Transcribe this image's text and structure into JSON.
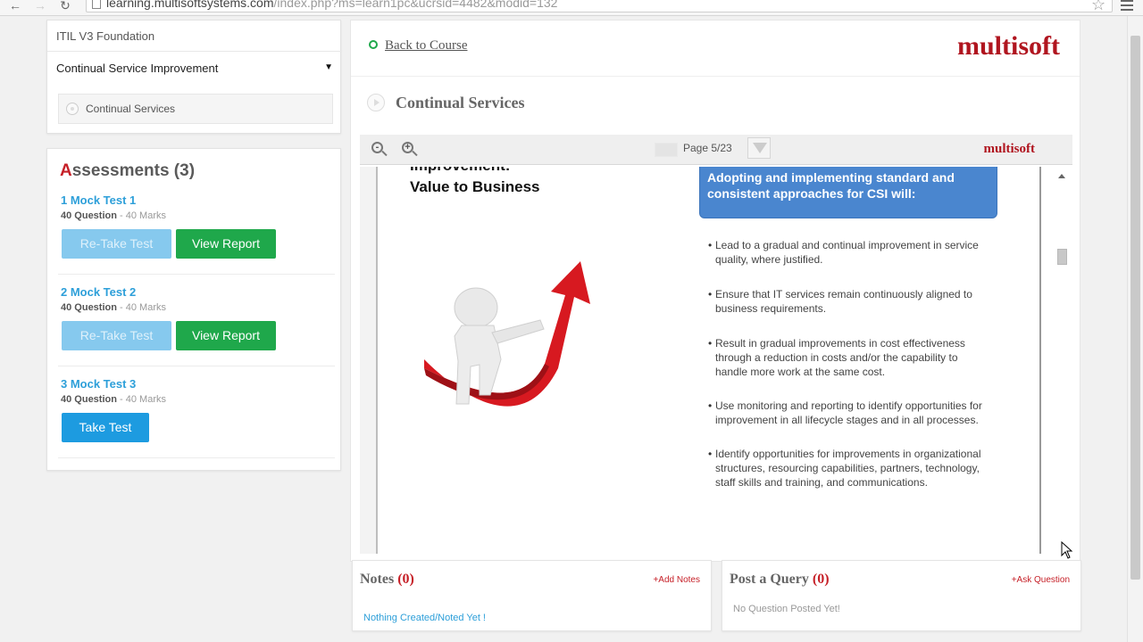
{
  "browser": {
    "url_host": "learning.multisoftsystems.com",
    "url_path": "/index.php?ms=learn1pc&ucrsid=4482&modid=132"
  },
  "sidebar": {
    "course_title": "ITIL V3 Foundation",
    "module": "Continual Service Improvement",
    "lesson": "Continual Services"
  },
  "assessments": {
    "title_first": "A",
    "title_rest": "ssessments (3)",
    "tests": [
      {
        "name": "1 Mock Test 1",
        "questions": "40 Question",
        "marks": " - 40 Marks",
        "primary_label": "Re-Take Test",
        "secondary_label": "View Report"
      },
      {
        "name": "2 Mock Test 2",
        "questions": "40 Question",
        "marks": " - 40 Marks",
        "primary_label": "Re-Take Test",
        "secondary_label": "View Report"
      },
      {
        "name": "3 Mock Test 3",
        "questions": "40 Question",
        "marks": " - 40 Marks",
        "primary_label": "Take Test"
      }
    ]
  },
  "main": {
    "back_label": "Back to Course",
    "logo": "multisoft",
    "lesson_title": "Continual Services"
  },
  "viewer": {
    "page_indicator": "Page 5/23",
    "logo": "multisoft"
  },
  "slide": {
    "title_line1": "Improvement:",
    "title_line2": "Value to Business",
    "callout": "Adopting and implementing standard and consistent approaches for CSI will:",
    "bullets": [
      "Lead to a gradual and continual improvement in service quality, where justified.",
      "Ensure that IT services remain continuously aligned to business requirements.",
      "Result in gradual improvements in cost effectiveness through a reduction in costs and/or the capability to handle more work at the same cost.",
      "Use monitoring and reporting to identify opportunities for improvement in all lifecycle stages and in all processes.",
      "Identify opportunities for improvements in organizational structures, resourcing capabilities, partners, technology, staff skills and training, and communications."
    ]
  },
  "notes": {
    "title": "Notes ",
    "count": "(0)",
    "action": "+Add Notes",
    "empty": "Nothing Created/Noted Yet !"
  },
  "query": {
    "title": "Post a Query ",
    "count": "(0)",
    "action": "+Ask Question",
    "empty": "No Question Posted Yet!"
  },
  "colors": {
    "brand_red": "#b0151f",
    "view_report_green": "#1fa84b",
    "take_test_blue": "#1d9be0",
    "retake_disabled_blue": "#86c9ee",
    "callout_blue": "#4a86cf"
  }
}
